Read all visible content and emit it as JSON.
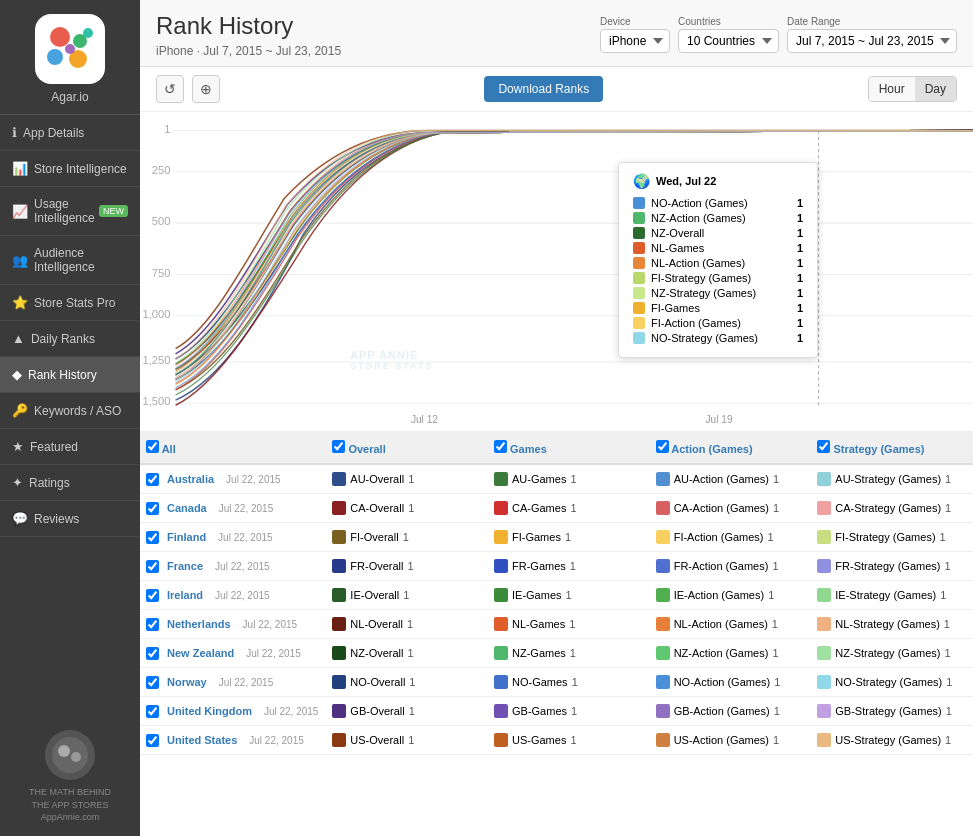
{
  "sidebar": {
    "app_name": "Agar.io",
    "items": [
      {
        "id": "app-details",
        "label": "App Details",
        "icon": "ℹ",
        "active": false
      },
      {
        "id": "store-intelligence",
        "label": "Store Intelligence",
        "icon": "📊",
        "active": false
      },
      {
        "id": "usage-intelligence",
        "label": "Usage Intelligence",
        "icon": "📈",
        "badge": "NEW",
        "active": false
      },
      {
        "id": "audience-intelligence",
        "label": "Audience Intelligence",
        "icon": "👥",
        "active": false
      },
      {
        "id": "store-stats-pro",
        "label": "Store Stats Pro",
        "icon": "⭐",
        "active": false
      },
      {
        "id": "daily-ranks",
        "label": "Daily Ranks",
        "icon": "▲",
        "active": false
      },
      {
        "id": "rank-history",
        "label": "Rank History",
        "icon": "◆",
        "active": true
      },
      {
        "id": "keywords-aso",
        "label": "Keywords / ASO",
        "icon": "🔑",
        "active": false
      },
      {
        "id": "featured",
        "label": "Featured",
        "icon": "★",
        "active": false
      },
      {
        "id": "ratings",
        "label": "Ratings",
        "icon": "✦",
        "active": false
      },
      {
        "id": "reviews",
        "label": "Reviews",
        "icon": "💬",
        "active": false
      }
    ],
    "bottom_text": "THE MATH BEHIND\nTHE APP STORES\nAppAnnie.com"
  },
  "header": {
    "title": "Rank History",
    "subtitle": "iPhone · Jul 7, 2015 ~ Jul 23, 2015",
    "device_label": "Device",
    "device_value": "iPhone",
    "countries_label": "Countries",
    "countries_value": "10 Countries",
    "date_range_label": "Date Range",
    "date_range_value": "Jul 7, 2015 ~ Jul 23, 2015"
  },
  "toolbar": {
    "download_label": "Download Ranks",
    "hour_label": "Hour",
    "day_label": "Day",
    "active_toggle": "Day"
  },
  "chart": {
    "y_labels": [
      "1",
      "250",
      "500",
      "750",
      "1,000",
      "1,250",
      "1,500"
    ],
    "x_labels": [
      "Jul 12",
      "Jul 19"
    ],
    "tooltip": {
      "title": "Wed, Jul 22",
      "rows": [
        {
          "label": "NO-Action (Games)",
          "value": "1",
          "color": "#4a90d9"
        },
        {
          "label": "NZ-Action (Games)",
          "value": "1",
          "color": "#50b86c"
        },
        {
          "label": "NZ-Overall",
          "value": "1",
          "color": "#2d6a2d"
        },
        {
          "label": "NL-Games",
          "value": "1",
          "color": "#e05c2a"
        },
        {
          "label": "NL-Action (Games)",
          "value": "1",
          "color": "#e8873a"
        },
        {
          "label": "FI-Strategy (Games)",
          "value": "1",
          "color": "#b8d86a"
        },
        {
          "label": "NZ-Strategy (Games)",
          "value": "1",
          "color": "#c8e890"
        },
        {
          "label": "FI-Games",
          "value": "1",
          "color": "#f0b030"
        },
        {
          "label": "FI-Action (Games)",
          "value": "1",
          "color": "#f8d060"
        },
        {
          "label": "NO-Strategy (Games)",
          "value": "1",
          "color": "#90d8e8"
        }
      ]
    }
  },
  "table": {
    "headers": {
      "all": "All",
      "overall": "Overall",
      "games": "Games",
      "action_games": "Action (Games)",
      "strategy_games": "Strategy (Games)"
    },
    "rows": [
      {
        "country": "Australia",
        "date": "Jul 22, 2015",
        "overall": {
          "label": "AU-Overall",
          "color": "#2e4d8a"
        },
        "overall_rank": "1",
        "games": {
          "label": "AU-Games",
          "color": "#3a7a3a"
        },
        "games_rank": "1",
        "action": {
          "label": "AU-Action (Games)",
          "color": "#5090d0"
        },
        "action_rank": "1",
        "strategy": {
          "label": "AU-Strategy (Games)",
          "color": "#90d0d8"
        },
        "strategy_rank": "1"
      },
      {
        "country": "Canada",
        "date": "Jul 22, 2015",
        "overall": {
          "label": "CA-Overall",
          "color": "#8a2020"
        },
        "overall_rank": "1",
        "games": {
          "label": "CA-Games",
          "color": "#d03030"
        },
        "games_rank": "1",
        "action": {
          "label": "CA-Action (Games)",
          "color": "#d86060"
        },
        "action_rank": "1",
        "strategy": {
          "label": "CA-Strategy (Games)",
          "color": "#f0a0a0"
        },
        "strategy_rank": "1"
      },
      {
        "country": "Finland",
        "date": "Jul 22, 2015",
        "overall": {
          "label": "FI-Overall",
          "color": "#7a6020"
        },
        "overall_rank": "1",
        "games": {
          "label": "FI-Games",
          "color": "#f0b030"
        },
        "games_rank": "1",
        "action": {
          "label": "FI-Action (Games)",
          "color": "#f8d060"
        },
        "action_rank": "1",
        "strategy": {
          "label": "FI-Strategy (Games)",
          "color": "#c8dc80"
        },
        "strategy_rank": "1"
      },
      {
        "country": "France",
        "date": "Jul 22, 2015",
        "overall": {
          "label": "FR-Overall",
          "color": "#2a3a8a"
        },
        "overall_rank": "1",
        "games": {
          "label": "FR-Games",
          "color": "#3050c0"
        },
        "games_rank": "1",
        "action": {
          "label": "FR-Action (Games)",
          "color": "#5070d0"
        },
        "action_rank": "1",
        "strategy": {
          "label": "FR-Strategy (Games)",
          "color": "#9090e0"
        },
        "strategy_rank": "1"
      },
      {
        "country": "Ireland",
        "date": "Jul 22, 2015",
        "overall": {
          "label": "IE-Overall",
          "color": "#2a5c2a"
        },
        "overall_rank": "1",
        "games": {
          "label": "IE-Games",
          "color": "#3a8c3a"
        },
        "games_rank": "1",
        "action": {
          "label": "IE-Action (Games)",
          "color": "#50b050"
        },
        "action_rank": "1",
        "strategy": {
          "label": "IE-Strategy (Games)",
          "color": "#90d890"
        },
        "strategy_rank": "1"
      },
      {
        "country": "Netherlands",
        "date": "Jul 22, 2015",
        "overall": {
          "label": "NL-Overall",
          "color": "#6a2010"
        },
        "overall_rank": "1",
        "games": {
          "label": "NL-Games",
          "color": "#e05c2a"
        },
        "games_rank": "1",
        "action": {
          "label": "NL-Action (Games)",
          "color": "#e8803a"
        },
        "action_rank": "1",
        "strategy": {
          "label": "NL-Strategy (Games)",
          "color": "#f0b080"
        },
        "strategy_rank": "1"
      },
      {
        "country": "New Zealand",
        "date": "Jul 22, 2015",
        "overall": {
          "label": "NZ-Overall",
          "color": "#1a4a1a"
        },
        "overall_rank": "1",
        "games": {
          "label": "NZ-Games",
          "color": "#50b86c"
        },
        "games_rank": "1",
        "action": {
          "label": "NZ-Action (Games)",
          "color": "#60c870"
        },
        "action_rank": "1",
        "strategy": {
          "label": "NZ-Strategy (Games)",
          "color": "#a0e0a0"
        },
        "strategy_rank": "1"
      },
      {
        "country": "Norway",
        "date": "Jul 22, 2015",
        "overall": {
          "label": "NO-Overall",
          "color": "#204080"
        },
        "overall_rank": "1",
        "games": {
          "label": "NO-Games",
          "color": "#4070c8"
        },
        "games_rank": "1",
        "action": {
          "label": "NO-Action (Games)",
          "color": "#4a90d9"
        },
        "action_rank": "1",
        "strategy": {
          "label": "NO-Strategy (Games)",
          "color": "#90d8e8"
        },
        "strategy_rank": "1"
      },
      {
        "country": "United Kingdom",
        "date": "Jul 22, 2015",
        "overall": {
          "label": "GB-Overall",
          "color": "#503080"
        },
        "overall_rank": "1",
        "games": {
          "label": "GB-Games",
          "color": "#7050b0"
        },
        "games_rank": "1",
        "action": {
          "label": "GB-Action (Games)",
          "color": "#9070c0"
        },
        "action_rank": "1",
        "strategy": {
          "label": "GB-Strategy (Games)",
          "color": "#c0a0e0"
        },
        "strategy_rank": "1"
      },
      {
        "country": "United States",
        "date": "Jul 22, 2015",
        "overall": {
          "label": "US-Overall",
          "color": "#8a3a10"
        },
        "overall_rank": "1",
        "games": {
          "label": "US-Games",
          "color": "#c06020"
        },
        "games_rank": "1",
        "action": {
          "label": "US-Action (Games)",
          "color": "#d08040"
        },
        "action_rank": "1",
        "strategy": {
          "label": "US-Strategy (Games)",
          "color": "#e8b880"
        },
        "strategy_rank": "1"
      }
    ]
  }
}
